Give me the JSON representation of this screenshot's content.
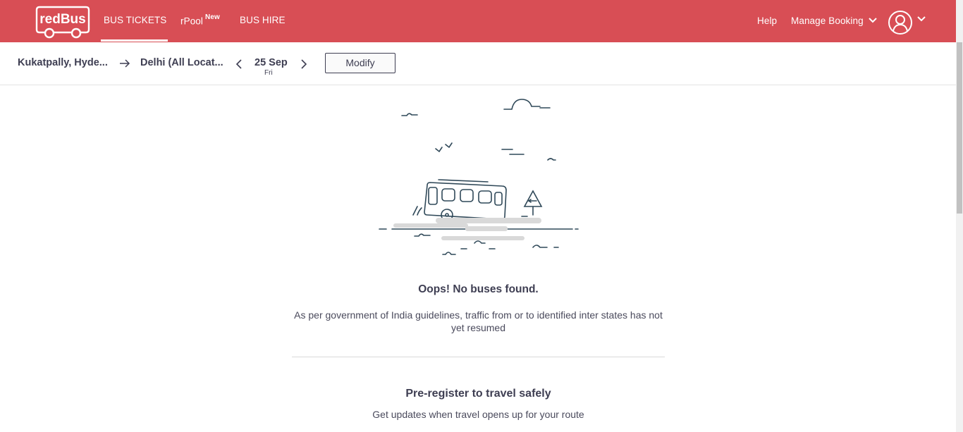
{
  "header": {
    "logo_text": "redBus",
    "nav": {
      "bus_tickets": "BUS TICKETS",
      "rpool": "rPool",
      "rpool_badge": "New",
      "bus_hire": "BUS HIRE",
      "help": "Help",
      "manage_booking": "Manage Booking"
    },
    "brand_color": "#d84e55"
  },
  "search": {
    "source": "Kukatpally, Hyde...",
    "destination": "Delhi (All Locat...",
    "date": "25 Sep",
    "day": "Fri",
    "modify_label": "Modify"
  },
  "empty_state": {
    "title": "Oops! No buses found.",
    "description": "As per government of India guidelines, traffic from or to identified inter states has not yet resumed"
  },
  "preregister": {
    "title": "Pre-register to travel safely",
    "description": "Get updates when travel opens up for your route"
  },
  "icons": [
    "redbus-logo-icon",
    "chevron-down-icon",
    "user-avatar-icon",
    "arrow-right-icon",
    "chevron-left-icon",
    "chevron-right-icon",
    "bus-illustration"
  ]
}
